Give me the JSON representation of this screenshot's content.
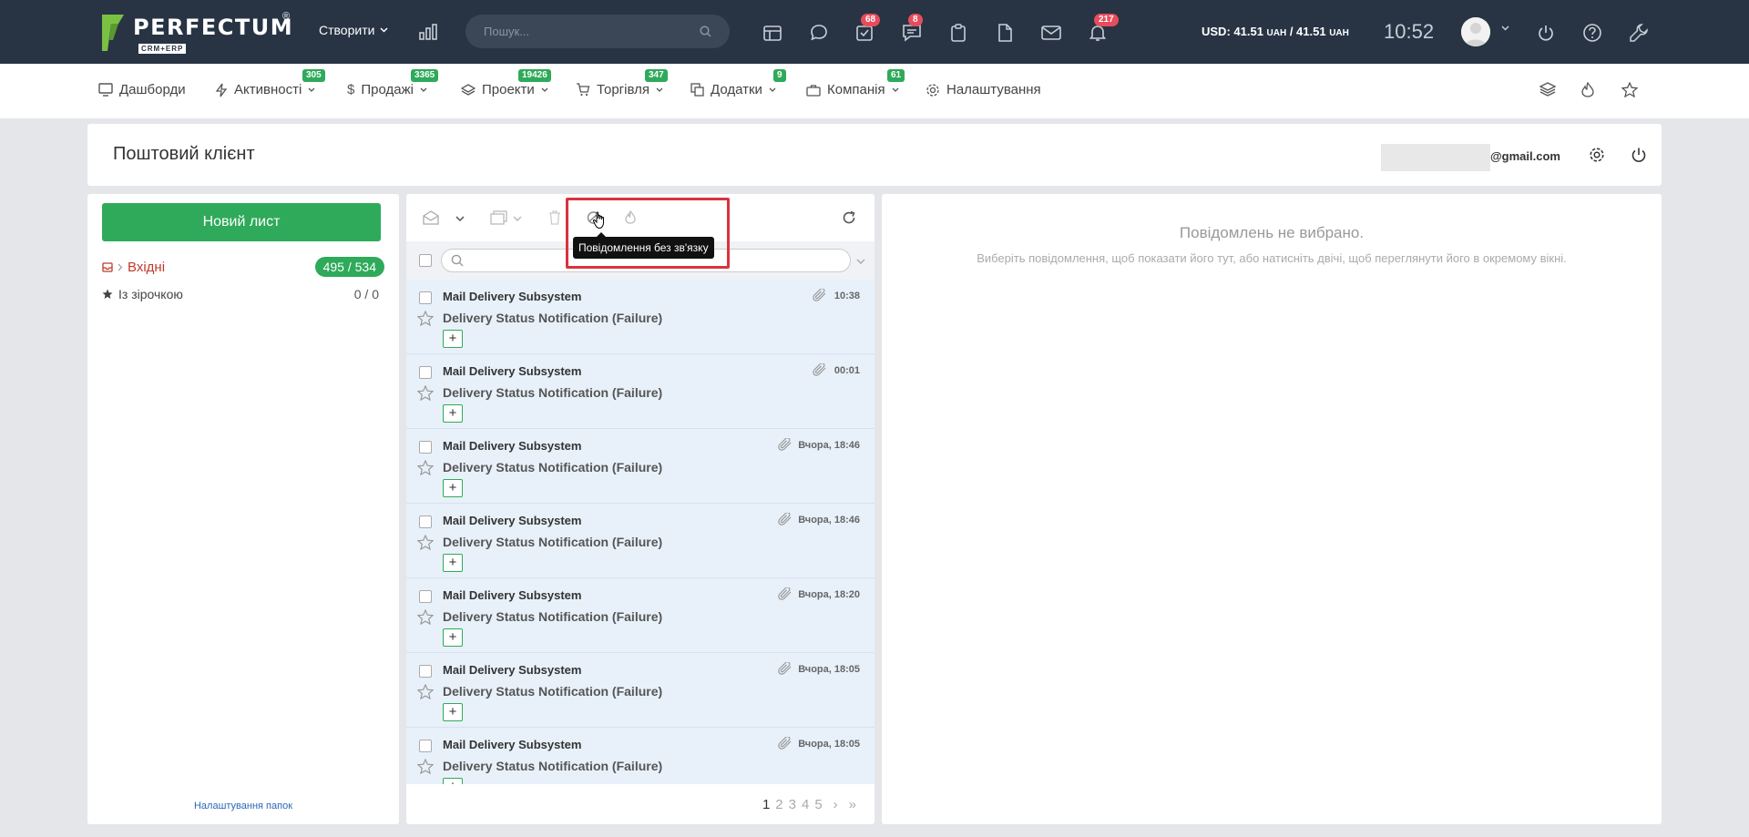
{
  "topbar": {
    "logo_text": "PERFECTUM",
    "logo_reg": "®",
    "logo_sub": "CRM+ERP",
    "create_label": "Створити",
    "search_placeholder": "Пошук...",
    "badges": {
      "tasks": "68",
      "chat": "8",
      "notifications": "217"
    },
    "currency_prefix": "USD: 41.51 ",
    "currency_unit1": "UAH",
    "currency_mid": " / 41.51 ",
    "currency_unit2": "UAH",
    "clock": "10:52"
  },
  "nav": {
    "items": [
      {
        "label": "Дашборди",
        "badge": ""
      },
      {
        "label": "Активності",
        "badge": "305"
      },
      {
        "label": "Продажі",
        "badge": "3365"
      },
      {
        "label": "Проекти",
        "badge": "19426"
      },
      {
        "label": "Торгівля",
        "badge": "347"
      },
      {
        "label": "Додатки",
        "badge": "9"
      },
      {
        "label": "Компанія",
        "badge": "61"
      },
      {
        "label": "Налаштування",
        "badge": ""
      }
    ]
  },
  "header": {
    "title": "Поштовий клієнт",
    "email_suffix": "@gmail.com"
  },
  "left": {
    "new_mail": "Новий лист",
    "folders": [
      {
        "label": "Вхідні",
        "count": "495 / 534"
      },
      {
        "label": "Із зірочкою",
        "count": "0 / 0"
      }
    ],
    "folder_settings": "Налаштування папок"
  },
  "tooltip": "Повідомлення без зв'язку",
  "messages": [
    {
      "from": "Mail Delivery Subsystem",
      "subject": "Delivery Status Notification (Failure)",
      "time": "10:38"
    },
    {
      "from": "Mail Delivery Subsystem",
      "subject": "Delivery Status Notification (Failure)",
      "time": "00:01"
    },
    {
      "from": "Mail Delivery Subsystem",
      "subject": "Delivery Status Notification (Failure)",
      "time": "Вчора, 18:46"
    },
    {
      "from": "Mail Delivery Subsystem",
      "subject": "Delivery Status Notification (Failure)",
      "time": "Вчора, 18:46"
    },
    {
      "from": "Mail Delivery Subsystem",
      "subject": "Delivery Status Notification (Failure)",
      "time": "Вчора, 18:20"
    },
    {
      "from": "Mail Delivery Subsystem",
      "subject": "Delivery Status Notification (Failure)",
      "time": "Вчора, 18:05"
    },
    {
      "from": "Mail Delivery Subsystem",
      "subject": "Delivery Status Notification (Failure)",
      "time": "Вчора, 18:05"
    }
  ],
  "pager": {
    "pages": [
      "1",
      "2",
      "3",
      "4",
      "5"
    ],
    "next": "›",
    "last": "»"
  },
  "right": {
    "empty_title": "Повідомлень не вибрано.",
    "empty_sub": "Виберіть повідомлення, щоб показати його тут, або натисніть двічі, щоб переглянути його в окремому вікні."
  },
  "colors": {
    "topbar": "#283444",
    "accent_green": "#2eaa5a",
    "badge_red": "#e74c5d",
    "highlight": "#d9333f",
    "logo_green": "#7ac143"
  }
}
